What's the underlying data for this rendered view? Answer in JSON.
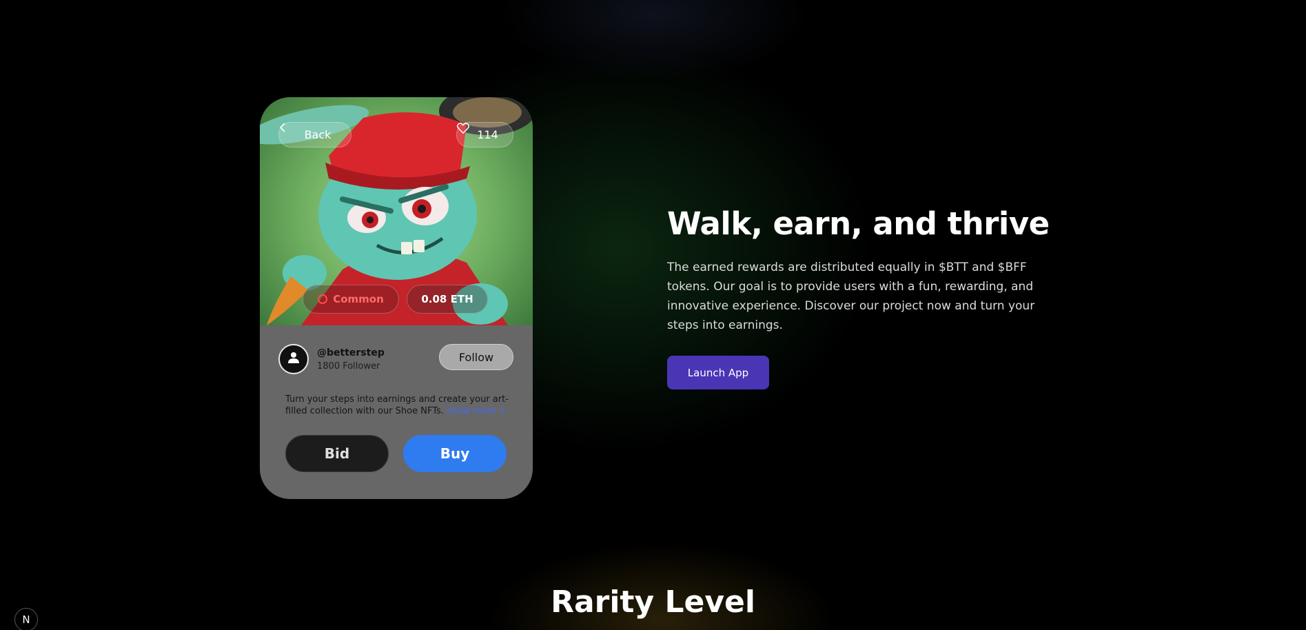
{
  "card": {
    "back_label": "Back",
    "likes": "114",
    "rarity": "Common",
    "price": "0.08 ETH",
    "user_handle": "@betterstep",
    "followers": "1800 Follower",
    "follow_label": "Follow",
    "description": "Turn your steps into earnings and create your art-filled collection with our Shoe NFTs.",
    "show_more": "show more >",
    "bid_label": "Bid",
    "buy_label": "Buy"
  },
  "hero": {
    "title": "Walk, earn, and thrive",
    "text": "The earned rewards are distributed equally in $BTT and $BFF tokens. Our goal is to provide users with a fun, rewarding, and innovative experience. Discover our project now and turn your steps into earnings.",
    "launch_label": "Launch App"
  },
  "section": {
    "title": "Rarity Level"
  },
  "badge": {
    "letter": "N"
  },
  "colors": {
    "buy": "#2f7bf0",
    "launch": "#4a35b5",
    "rarity": "#ff4b4b",
    "show_more": "#3f6cf0"
  },
  "icons": [
    "chevron-left-icon",
    "heart-icon",
    "user-icon",
    "rarity-circle-icon"
  ]
}
